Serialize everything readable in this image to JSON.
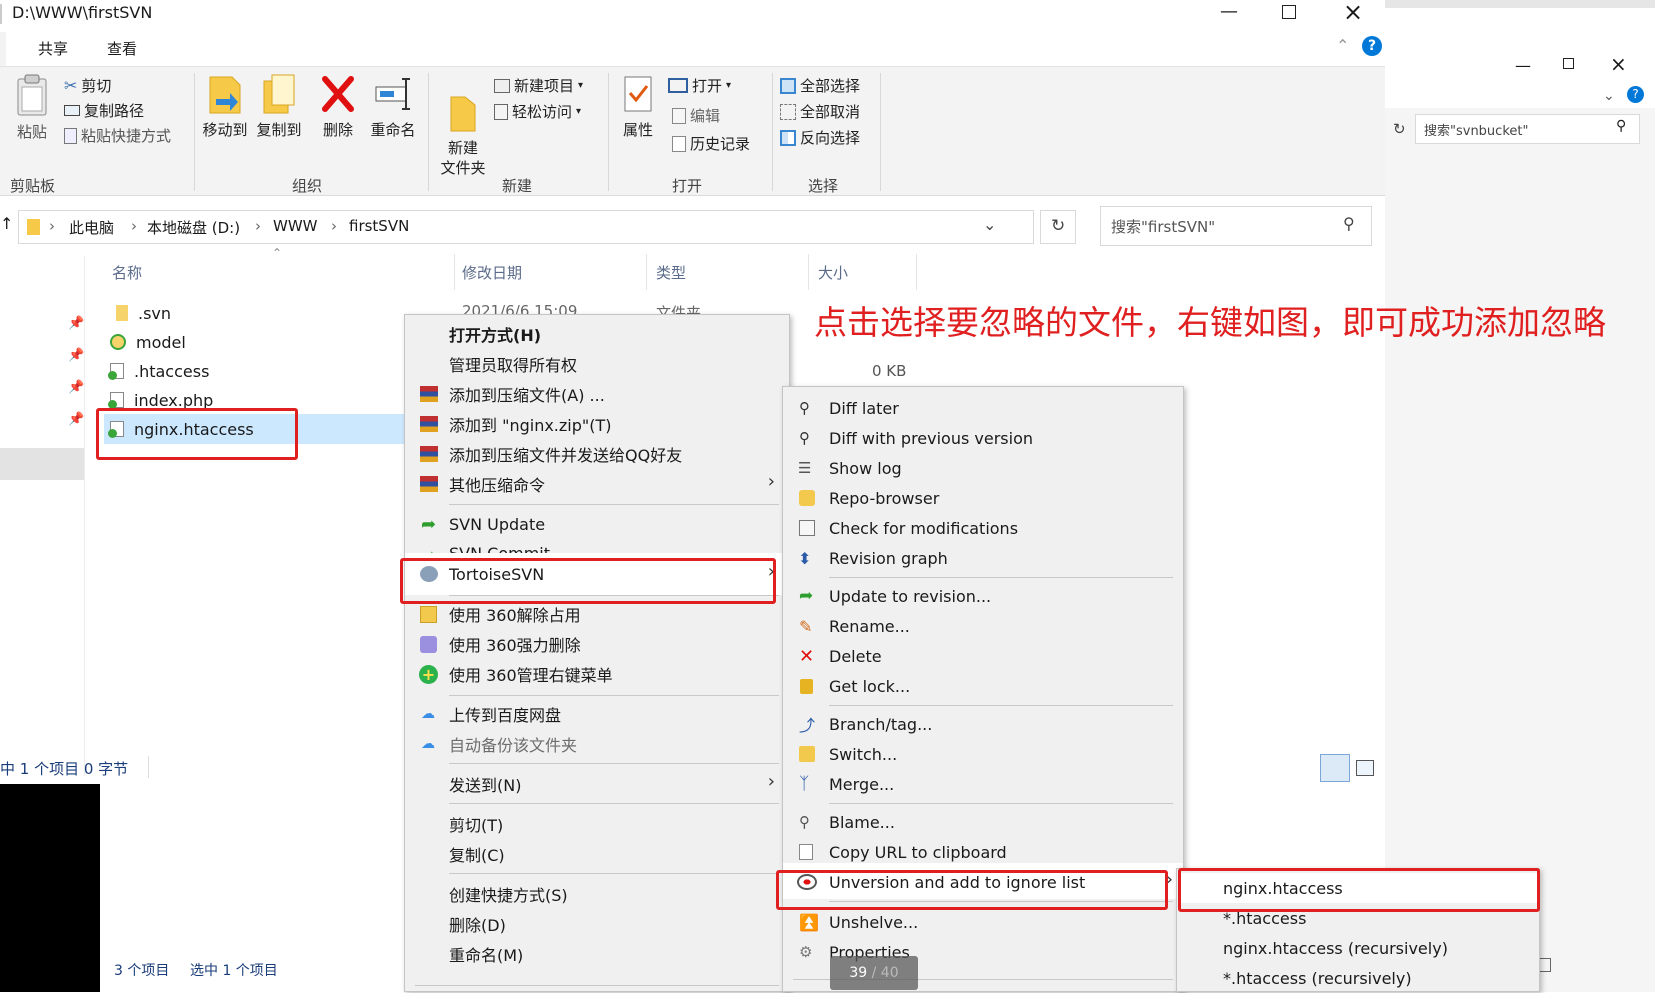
{
  "window": {
    "path_title": "D:\\WWW\\firstSVN"
  },
  "tabs": {
    "share": "共享",
    "view": "查看"
  },
  "ribbon": {
    "clipboard": {
      "paste": "粘贴",
      "cut": "剪切",
      "copy_path": "复制路径",
      "paste_shortcut": "粘贴快捷方式",
      "label": "剪贴板"
    },
    "organize": {
      "move_to": "移动到",
      "copy_to": "复制到",
      "delete": "删除",
      "rename": "重命名",
      "label": "组织"
    },
    "new": {
      "new_folder": "新建\n文件夹",
      "new_item": "新建项目",
      "easy_access": "轻松访问",
      "label": "新建"
    },
    "open": {
      "properties": "属性",
      "open": "打开",
      "edit": "编辑",
      "history": "历史记录",
      "label": "打开"
    },
    "select": {
      "select_all": "全部选择",
      "select_none": "全部取消",
      "invert": "反向选择",
      "label": "选择"
    }
  },
  "address": {
    "crumbs": [
      "此电脑",
      "本地磁盘 (D:)",
      "WWW",
      "firstSVN"
    ],
    "search_placeholder": "搜索\"firstSVN\""
  },
  "columns": {
    "name": "名称",
    "modified": "修改日期",
    "type": "类型",
    "size": "大小"
  },
  "files": [
    {
      "name": ".svn",
      "modified": "2021/6/6 15:09",
      "type": "文件夹",
      "size": ""
    },
    {
      "name": "model",
      "modified": "",
      "type": "",
      "size": ""
    },
    {
      "name": ".htaccess",
      "modified": "",
      "type": "",
      "size": "0 KB"
    },
    {
      "name": "index.php",
      "modified": "",
      "type": "",
      "size": ""
    },
    {
      "name": "nginx.htaccess",
      "modified": "",
      "type": "",
      "size": ""
    }
  ],
  "status": {
    "left_selection": "中 1 个项目  0 字节",
    "items": "3 个项目",
    "selected": "选中 1 个项目"
  },
  "annotation": "点击选择要忽略的文件，右键如图，即可成功添加忽略",
  "back_window": {
    "search_placeholder": "搜索\"svnbucket\""
  },
  "context_menu": [
    "打开方式(H)",
    "管理员取得所有权",
    "添加到压缩文件(A) ...",
    "添加到 \"nginx.zip\"(T)",
    "添加到压缩文件并发送给QQ好友",
    "其他压缩命令",
    "SVN Update",
    "SVN Commit...",
    "TortoiseSVN",
    "使用 360解除占用",
    "使用 360强力删除",
    "使用 360管理右键菜单",
    "上传到百度网盘",
    "自动备份该文件夹",
    "发送到(N)",
    "剪切(T)",
    "复制(C)",
    "创建快捷方式(S)",
    "删除(D)",
    "重命名(M)"
  ],
  "tsvn_menu": [
    "Diff later",
    "Diff with previous version",
    "Show log",
    "Repo-browser",
    "Check for modifications",
    "Revision graph",
    "Update to revision...",
    "Rename...",
    "Delete",
    "Get lock...",
    "Branch/tag...",
    "Switch...",
    "Merge...",
    "Blame...",
    "Copy URL to clipboard",
    "Unversion and add to ignore list",
    "Unshelve...",
    "Properties"
  ],
  "ignore_menu": [
    "nginx.htaccess",
    "*.htaccess",
    "nginx.htaccess (recursively)",
    "*.htaccess (recursively)"
  ],
  "page_badge": {
    "current": "39",
    "total": "/ 40"
  },
  "colors": {
    "accent": "#0078d7",
    "annotation_red": "#e02020",
    "selection": "#cce8ff",
    "menu_bg": "#f0f0f0"
  }
}
